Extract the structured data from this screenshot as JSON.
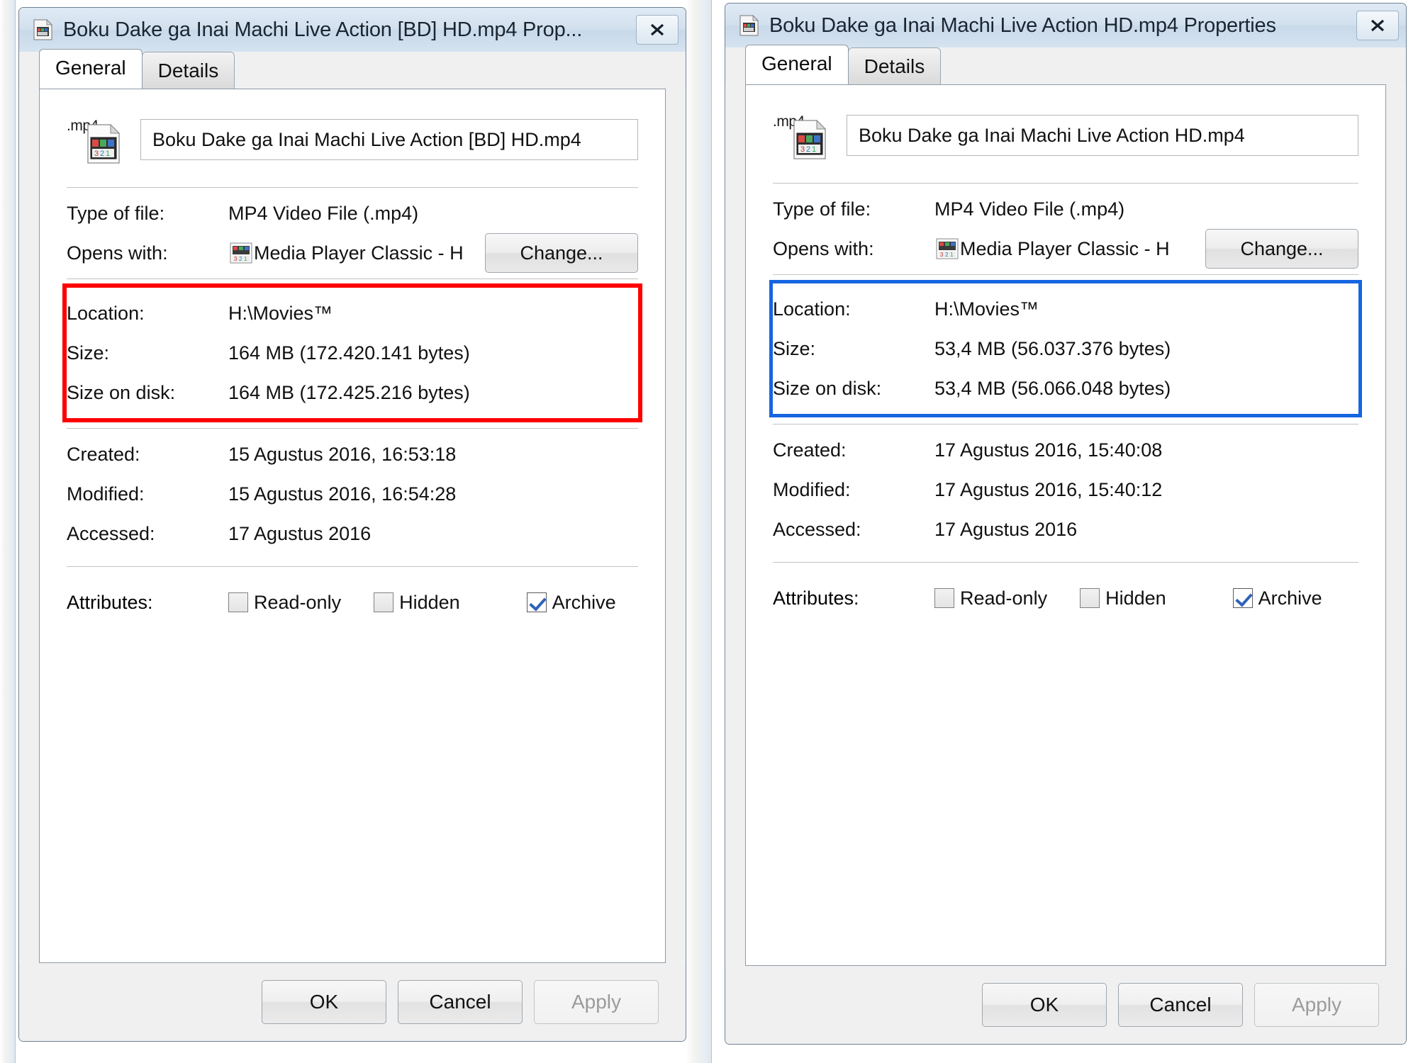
{
  "dialogs": [
    {
      "id": "left",
      "title": "Boku Dake ga Inai Machi Live Action [BD] HD.mp4 Prop...",
      "close_label": "✕",
      "tabs": [
        {
          "label": "General",
          "active": true
        },
        {
          "label": "Details",
          "active": false
        }
      ],
      "icon_ext": ".mp4",
      "filename": "Boku Dake ga Inai Machi Live Action [BD] HD.mp4",
      "fields": {
        "type_label": "Type of file:",
        "type_value": "MP4 Video File (.mp4)",
        "opens_label": "Opens with:",
        "opens_value": "Media Player Classic - H",
        "change_label": "Change...",
        "location_label": "Location:",
        "location_value": "H:\\Movies™",
        "size_label": "Size:",
        "size_value": "164 MB (172.420.141 bytes)",
        "size_on_disk_label": "Size on disk:",
        "size_on_disk_value": "164 MB (172.425.216 bytes)",
        "created_label": "Created:",
        "created_value": "15 Agustus 2016, 16:53:18",
        "modified_label": "Modified:",
        "modified_value": "15 Agustus 2016, 16:54:28",
        "accessed_label": "Accessed:",
        "accessed_value": "17 Agustus 2016",
        "attributes_label": "Attributes:"
      },
      "attributes": [
        {
          "label": "Read-only",
          "checked": false
        },
        {
          "label": "Hidden",
          "checked": false
        },
        {
          "label": "Archive",
          "checked": true
        }
      ],
      "buttons": [
        {
          "label": "OK",
          "enabled": true
        },
        {
          "label": "Cancel",
          "enabled": true
        },
        {
          "label": "Apply",
          "enabled": false
        }
      ],
      "highlight": {
        "color": "#fe0000",
        "name": "red-highlight-box"
      }
    },
    {
      "id": "right",
      "title": "Boku Dake ga Inai Machi Live Action HD.mp4 Properties",
      "close_label": "✕",
      "tabs": [
        {
          "label": "General",
          "active": true
        },
        {
          "label": "Details",
          "active": false
        }
      ],
      "icon_ext": ".mp4",
      "filename": "Boku Dake ga Inai Machi Live Action HD.mp4",
      "fields": {
        "type_label": "Type of file:",
        "type_value": "MP4 Video File (.mp4)",
        "opens_label": "Opens with:",
        "opens_value": "Media Player Classic - H",
        "change_label": "Change...",
        "location_label": "Location:",
        "location_value": "H:\\Movies™",
        "size_label": "Size:",
        "size_value": "53,4 MB (56.037.376 bytes)",
        "size_on_disk_label": "Size on disk:",
        "size_on_disk_value": "53,4 MB (56.066.048 bytes)",
        "created_label": "Created:",
        "created_value": "17 Agustus 2016, 15:40:08",
        "modified_label": "Modified:",
        "modified_value": "17 Agustus 2016, 15:40:12",
        "accessed_label": "Accessed:",
        "accessed_value": "17 Agustus 2016",
        "attributes_label": "Attributes:"
      },
      "attributes": [
        {
          "label": "Read-only",
          "checked": false
        },
        {
          "label": "Hidden",
          "checked": false
        },
        {
          "label": "Archive",
          "checked": true
        }
      ],
      "buttons": [
        {
          "label": "OK",
          "enabled": true
        },
        {
          "label": "Cancel",
          "enabled": true
        },
        {
          "label": "Apply",
          "enabled": false
        }
      ],
      "highlight": {
        "color": "#1565e0",
        "name": "blue-highlight-box"
      }
    }
  ]
}
